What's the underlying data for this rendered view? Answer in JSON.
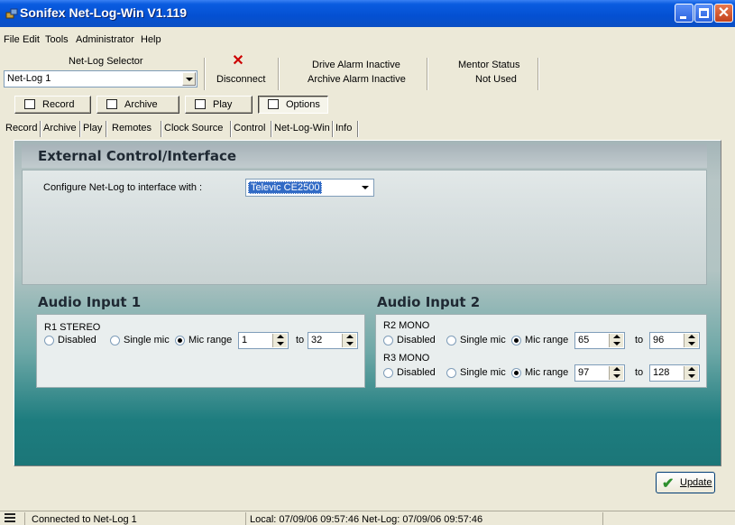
{
  "window": {
    "title": "Sonifex Net-Log-Win V1.119",
    "title_bar_color": "#0a5ce0",
    "close_button_color": "#c2421d"
  },
  "menu": [
    {
      "label": "File"
    },
    {
      "label": "Edit"
    },
    {
      "label": "Tools"
    },
    {
      "label": "Administrator"
    },
    {
      "label": "Help"
    }
  ],
  "info": {
    "selector_label": "Net-Log Selector",
    "selector_value": "Net-Log 1",
    "disconnect_label": "Disconnect",
    "disconnect_icon": "red-x-icon",
    "drive_alarm": "Drive Alarm Inactive",
    "archive_alarm": "Archive Alarm Inactive",
    "mentor_label": "Mentor Status",
    "mentor_value": "Not Used"
  },
  "modes": [
    {
      "label": "Record",
      "icon": "record-icon",
      "pressed": false
    },
    {
      "label": "Archive",
      "icon": "archive-icon",
      "pressed": false
    },
    {
      "label": "Play",
      "icon": "play-icon",
      "pressed": false
    },
    {
      "label": "Options",
      "icon": "options-icon",
      "pressed": true
    }
  ],
  "tabs": [
    {
      "label": "Record"
    },
    {
      "label": "Archive"
    },
    {
      "label": "Play"
    },
    {
      "label": "Remotes"
    },
    {
      "label": "Clock Source"
    },
    {
      "label": "Control",
      "active": true
    },
    {
      "label": "Net-Log-Win"
    },
    {
      "label": "Info"
    }
  ],
  "external": {
    "title": "External Control/Interface",
    "configure_label": "Configure Net-Log to interface with :",
    "configure_value": "Televic CE2500"
  },
  "audio1": {
    "title": "Audio Input 1",
    "channels": [
      {
        "name": "R1 STEREO",
        "disabled": "Disabled",
        "single": "Single mic",
        "range": "Mic range",
        "selected": "range",
        "from": "1",
        "to_label": "to",
        "to": "32"
      }
    ]
  },
  "audio2": {
    "title": "Audio Input 2",
    "channels": [
      {
        "name": "R2 MONO",
        "disabled": "Disabled",
        "single": "Single mic",
        "range": "Mic range",
        "selected": "range",
        "from": "65",
        "to_label": "to",
        "to": "96"
      },
      {
        "name": "R3 MONO",
        "disabled": "Disabled",
        "single": "Single mic",
        "range": "Mic range",
        "selected": "range",
        "from": "97",
        "to_label": "to",
        "to": "128"
      }
    ]
  },
  "update_button": {
    "label": "Update",
    "icon": "checkmark-icon"
  },
  "status": {
    "connection": "Connected to Net-Log 1",
    "times": "Local: 07/09/06 09:57:46   Net-Log: 07/09/06 09:57:46"
  }
}
